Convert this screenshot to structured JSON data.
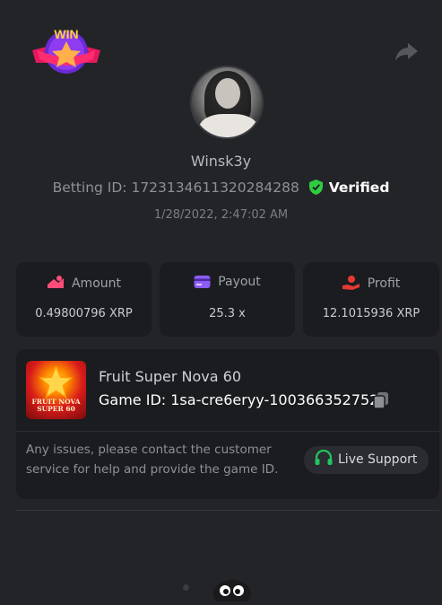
{
  "header": {
    "badge_text": "WIN",
    "badge_icon": "win-star-badge",
    "share_icon": "share-arrow-icon"
  },
  "user": {
    "username": "Winsk3y",
    "betting_id_label": "Betting ID:",
    "betting_id": "1723134611320284288",
    "verified_label": "Verified",
    "timestamp": "1/28/2022, 2:47:02 AM"
  },
  "stats": {
    "amount": {
      "label": "Amount",
      "value": "0.49800796 XRP",
      "icon": "amount-icon"
    },
    "payout": {
      "label": "Payout",
      "value": "25.3 x",
      "icon": "payout-card-icon"
    },
    "profit": {
      "label": "Profit",
      "value": "12.1015936 XRP",
      "icon": "profit-hand-icon"
    }
  },
  "game": {
    "name": "Fruit Super Nova 60",
    "id_label": "Game ID:",
    "id_value": "1sa-cre6eryy-1003663527522",
    "thumb_line1": "FRUIT NOVA",
    "thumb_line2": "SUPER 60"
  },
  "support": {
    "help_text": "Any issues, please contact the customer service for help and provide the game ID.",
    "button_label": "Live Support"
  },
  "colors": {
    "background": "#232428",
    "card": "#1b1c1f",
    "verified_green": "#2ecc40",
    "support_green": "#22c55e",
    "amount_icon": "#ff4d7a",
    "payout_icon": "#8b5cf6",
    "profit_icon": "#e53935"
  }
}
